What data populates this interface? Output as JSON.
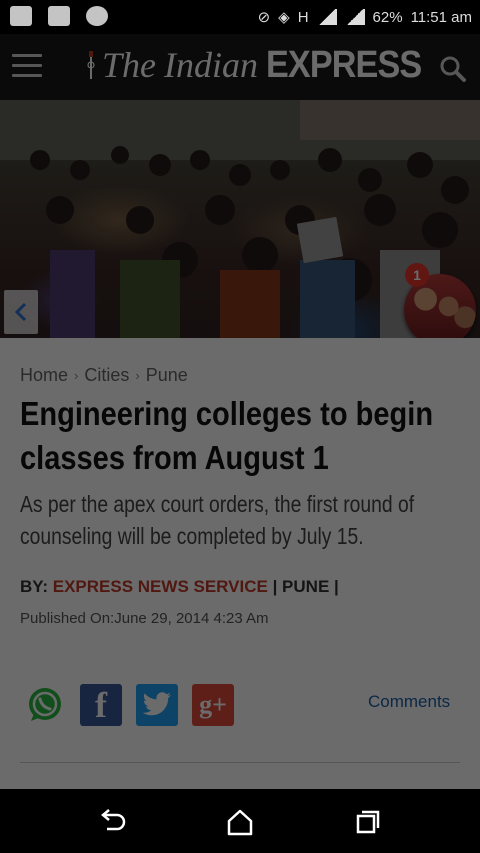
{
  "status_bar": {
    "battery": "62%",
    "time": "11:51 am"
  },
  "header": {
    "logo_the": "The",
    "logo_indian": "Indian",
    "logo_express": "EXPRESS",
    "menu_icon": "hamburger-menu-icon",
    "search_icon": "search-icon"
  },
  "hero": {
    "notification_count": "1"
  },
  "article": {
    "breadcrumb": [
      "Home",
      "Cities",
      "Pune"
    ],
    "headline_line1": "Engineering colleges to begin",
    "headline_line2": "classes from August 1",
    "summary": "As per the apex court orders, the first round of counseling will be completed by July 15.",
    "byline_prefix": "BY:",
    "byline_author": "EXPRESS NEWS SERVICE",
    "byline_suffix": "| PUNE |",
    "published": "Published On:June 29, 2014 4:23 Am",
    "comments_label": "Comments"
  },
  "share": {
    "facebook_glyph": "f",
    "googleplus_glyph": "g+"
  },
  "colors": {
    "headline": "#111111",
    "author": "#c0392b",
    "comments": "#1e5fa8",
    "whatsapp": "#2dbb42",
    "facebook": "#3b5998",
    "twitter": "#1da1f2",
    "googleplus": "#dd4b39"
  }
}
